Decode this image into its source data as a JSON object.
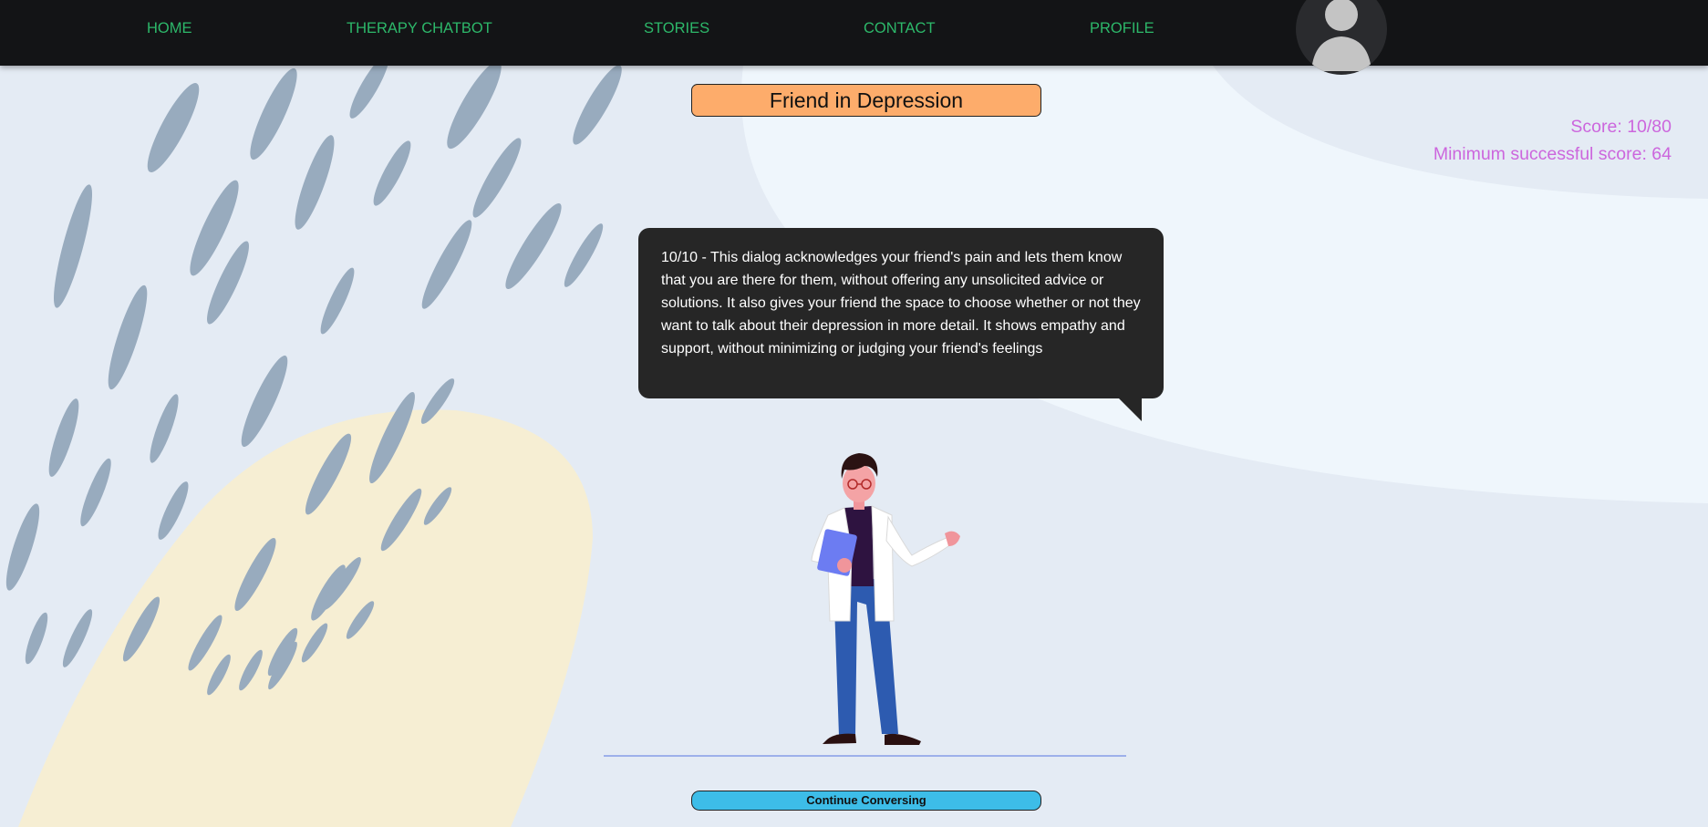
{
  "nav": {
    "home": "HOME",
    "chatbot": "THERAPY CHATBOT",
    "stories": "STORIES",
    "contact": "CONTACT",
    "profile": "PROFILE",
    "avatar_icon": "user-silhouette-icon"
  },
  "story": {
    "title": "Friend in Depression"
  },
  "score": {
    "text": "Score: 10/80",
    "minimum_text": "Minimum successful score: 64"
  },
  "feedback": {
    "text": "10/10 - This dialog acknowledges your friend's pain and lets them know that you are there for them, without offering any unsolicited advice or solutions. It also gives your friend the space to choose whether or not they want to talk about their depression in more detail. It shows empathy and support, without minimizing or judging your friend's feelings"
  },
  "actions": {
    "continue_label": "Continue Conversing"
  },
  "colors": {
    "navbar": "#131416",
    "nav_link": "#2db86a",
    "title_bg": "#fdac6b",
    "score_text": "#cc66dd",
    "bubble_bg": "#262626",
    "button_bg": "#3dbde8",
    "page_bg": "#e4ebf4",
    "leaf": "#98abbe",
    "blob": "#f6eed3"
  }
}
